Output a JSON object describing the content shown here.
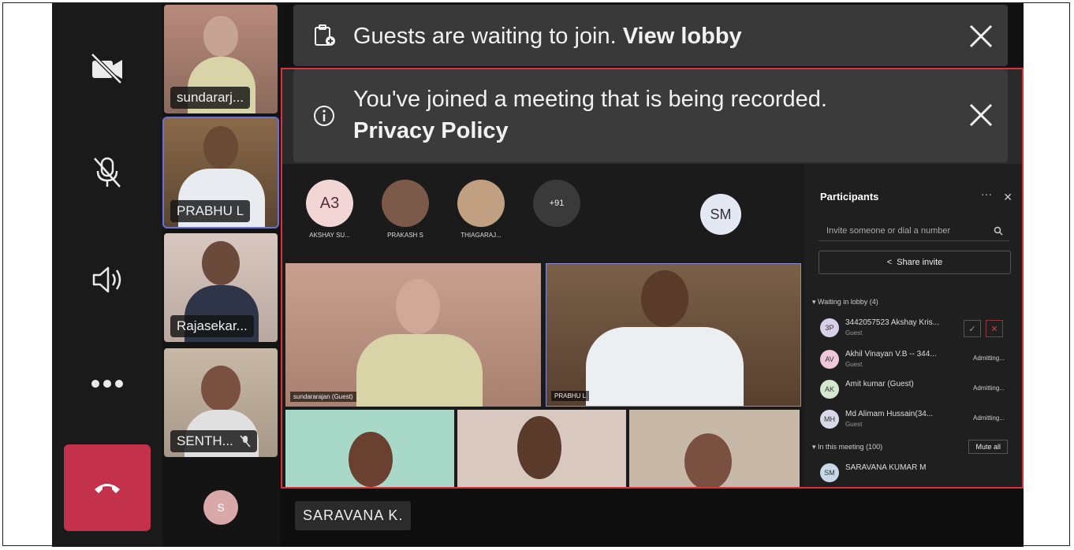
{
  "banners": {
    "lobby": {
      "text": "Guests are waiting to join.",
      "link": "View lobby"
    },
    "recording": {
      "line1": "You've joined a meeting that is being recorded.",
      "link": "Privacy Policy"
    }
  },
  "tiles": [
    {
      "name": "sundararj...",
      "muted": false
    },
    {
      "name": "PRABHU L",
      "muted": false
    },
    {
      "name": "Rajasekar...",
      "muted": false
    },
    {
      "name": "SENTH...",
      "muted": true
    }
  ],
  "self_avatar": "S",
  "bottom_name": "SARAVANA K.",
  "shared": {
    "avatars": [
      {
        "initials": "A3",
        "label": "AKSHAY SU...",
        "color": "#f2d6d6"
      },
      {
        "initials": "",
        "label": "PRAKASH S",
        "color": "#7b5a4a"
      },
      {
        "initials": "",
        "label": "THIAGARAJ...",
        "color": "#c0a080"
      },
      {
        "initials": "+91",
        "label": "",
        "color": "#3a3a3a"
      }
    ],
    "sm_initials": "SM",
    "video_labels": [
      "sundararajan (Guest)",
      "PRABHU L"
    ],
    "panel": {
      "title": "Participants",
      "search_placeholder": "Invite someone or dial a number",
      "share": "Share invite",
      "lobby_header": "Waiting in lobby (4)",
      "lobby": [
        {
          "initials": "3P",
          "name": "3442057523 Akshay Kris...",
          "sub": "Guest",
          "status": "",
          "color": "#d8d0e8"
        },
        {
          "initials": "AV",
          "name": "Akhil Vinayan V.B -- 344...",
          "sub": "Guest",
          "status": "Admitting...",
          "color": "#f0c8d8"
        },
        {
          "initials": "AK",
          "name": "Amit kumar (Guest)",
          "sub": "",
          "status": "Admitting...",
          "color": "#d4e8d0"
        },
        {
          "initials": "MH",
          "name": "Md Alimam Hussain(34...",
          "sub": "Guest",
          "status": "Admitting...",
          "color": "#d8d8e8"
        }
      ],
      "meeting_header": "In this meeting (100)",
      "mute_all": "Mute all",
      "meeting_first": {
        "initials": "SM",
        "name": "SARAVANA KUMAR M"
      }
    }
  }
}
